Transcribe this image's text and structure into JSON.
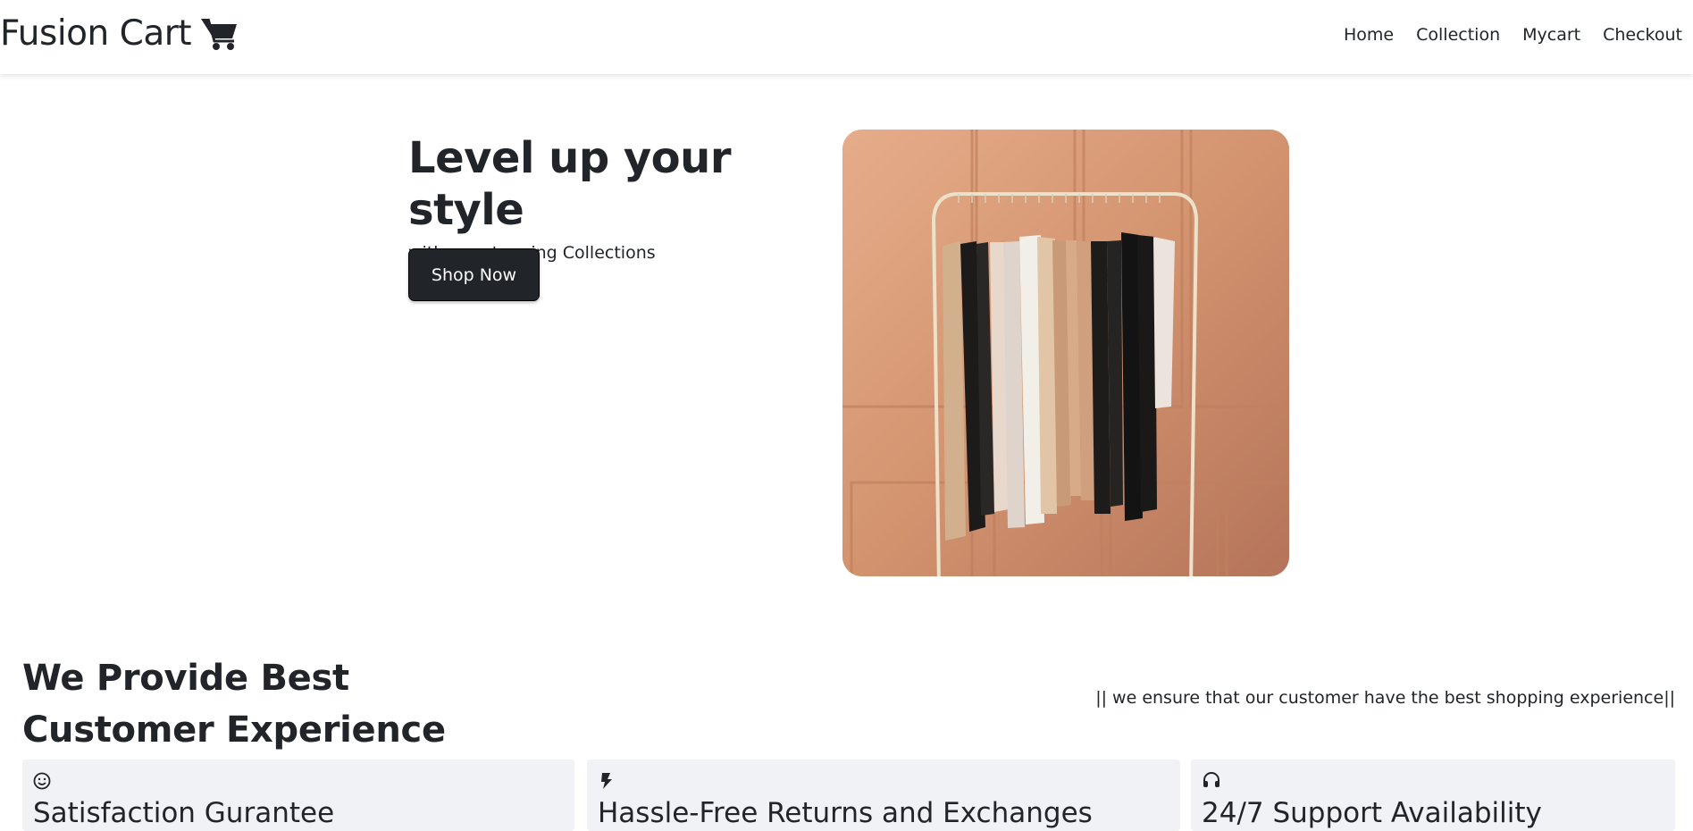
{
  "nav": {
    "brand": "Fusion Cart",
    "brand_icon": "shopping-cart-icon",
    "links": [
      "Home",
      "Collection",
      "Mycart",
      "Checkout"
    ]
  },
  "hero": {
    "title": "Level up your style",
    "subtitle": "with our stunning Collections",
    "button_label": "Shop Now",
    "image_alt": "clothes-rack-image"
  },
  "experience": {
    "title_line1": "We Provide Best",
    "title_line2": "Customer Experience",
    "tagline": "|| we ensure that our customer have the best shopping experience||"
  },
  "features": [
    {
      "icon": "smiley-icon",
      "title": "Satisfaction Gurantee"
    },
    {
      "icon": "lightning-icon",
      "title": "Hassle-Free Returns and Exchanges"
    },
    {
      "icon": "headset-icon",
      "title": "24/7 Support Availability"
    }
  ],
  "colors": {
    "button_bg": "#212529",
    "card_bg": "#f1f2f5",
    "image_bg": "#d8987a"
  }
}
